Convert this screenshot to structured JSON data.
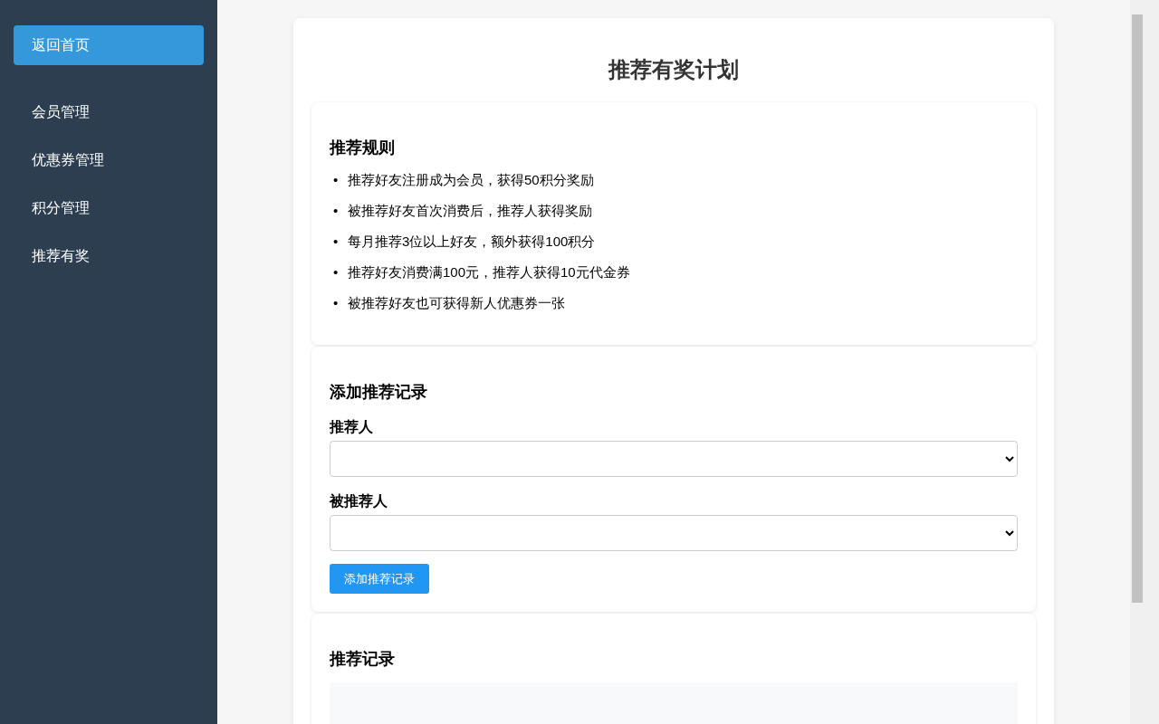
{
  "sidebar": {
    "back_button": "返回首页",
    "items": [
      {
        "label": "会员管理",
        "selected": false
      },
      {
        "label": "优惠券管理",
        "selected": false
      },
      {
        "label": "积分管理",
        "selected": false
      },
      {
        "label": "推荐有奖",
        "selected": false
      }
    ]
  },
  "title": "推荐有奖计划",
  "rules": {
    "title": "推荐规则",
    "items": [
      {
        "marker": "•",
        "text": "推荐好友注册成为会员，获得50积分奖励"
      },
      {
        "marker": "•",
        "text": "被推荐好友首次消费后，推荐人获得奖励"
      },
      {
        "marker": "•",
        "text": "每月推荐3位以上好友，额外获得100积分"
      },
      {
        "marker": "•",
        "text": "推荐好友消费满100元，推荐人获得10元代金券"
      },
      {
        "marker": "•",
        "text": "被推荐好友也可获得新人优惠券一张"
      }
    ]
  },
  "add_form": {
    "title": "添加推荐记录",
    "fields": [
      {
        "label": "推荐人"
      },
      {
        "label": "被推荐人"
      }
    ],
    "submit": "添加推荐记录"
  },
  "records": {
    "title": "推荐记录"
  }
}
